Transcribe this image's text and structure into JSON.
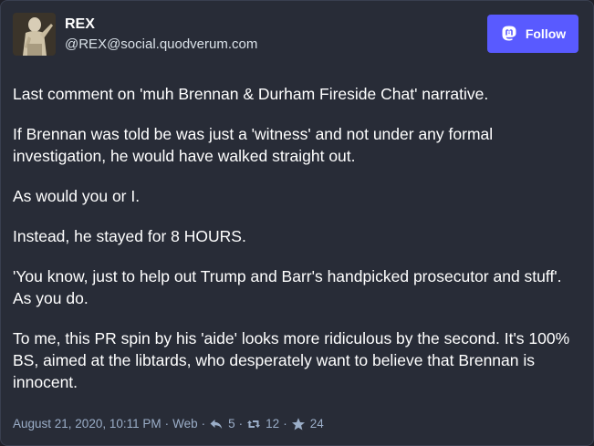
{
  "post": {
    "display_name": "REX",
    "acct": "@REX@social.quodverum.com",
    "follow_label": "Follow",
    "paragraphs": [
      "Last comment on 'muh Brennan & Durham Fireside Chat' narrative.",
      "If Brennan was told be was just a 'witness' and not under any formal investigation, he would have walked straight out.",
      "As would you or I.",
      "Instead, he stayed for 8 HOURS.",
      "'You know, just to help out Trump and Barr's handpicked prosecutor and stuff'. As you do.",
      "To me, this PR spin by his 'aide' looks more ridiculous by the second. It's 100% BS, aimed at the libtards, who desperately want to believe that Brennan is innocent."
    ],
    "timestamp": "August 21, 2020, 10:11 PM",
    "separator": "·",
    "source": "Web",
    "replies": "5",
    "boosts": "12",
    "favourites": "24"
  },
  "icons": {
    "avatar": "avatar-statue-icon",
    "mastodon": "mastodon-logo-icon",
    "reply": "reply-icon",
    "boost": "boost-icon",
    "favourite": "star-icon"
  },
  "colors": {
    "background": "#282c37",
    "follow_button": "#595aff",
    "meta_text": "#9baec8"
  }
}
